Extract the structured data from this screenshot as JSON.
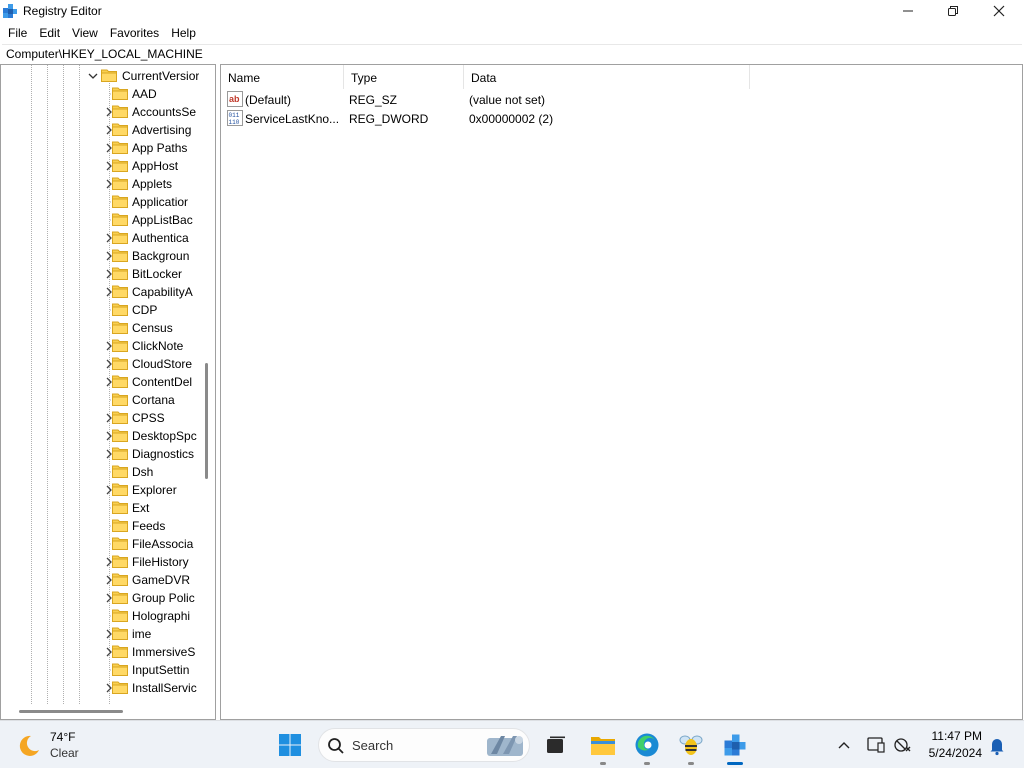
{
  "window": {
    "title": "Registry Editor",
    "icon": "registry-editor-icon",
    "controls": [
      "minimize-icon",
      "maximize-icon",
      "close-icon"
    ]
  },
  "menu": [
    "File",
    "Edit",
    "View",
    "Favorites",
    "Help"
  ],
  "address": "Computer\\HKEY_LOCAL_MACHINE",
  "tree": {
    "parent": {
      "label": "CurrentVersior",
      "expanded": true
    },
    "items": [
      {
        "label": "AAD",
        "expandable": false
      },
      {
        "label": "AccountsSe",
        "expandable": true
      },
      {
        "label": "Advertising",
        "expandable": true
      },
      {
        "label": "App Paths",
        "expandable": true
      },
      {
        "label": "AppHost",
        "expandable": true
      },
      {
        "label": "Applets",
        "expandable": true
      },
      {
        "label": "Applicatior",
        "expandable": false
      },
      {
        "label": "AppListBac",
        "expandable": false
      },
      {
        "label": "Authentica",
        "expandable": true
      },
      {
        "label": "Backgroun",
        "expandable": true
      },
      {
        "label": "BitLocker",
        "expandable": true
      },
      {
        "label": "CapabilityA",
        "expandable": true
      },
      {
        "label": "CDP",
        "expandable": false
      },
      {
        "label": "Census",
        "expandable": false
      },
      {
        "label": "ClickNote",
        "expandable": true
      },
      {
        "label": "CloudStore",
        "expandable": true
      },
      {
        "label": "ContentDel",
        "expandable": true
      },
      {
        "label": "Cortana",
        "expandable": false
      },
      {
        "label": "CPSS",
        "expandable": true
      },
      {
        "label": "DesktopSpc",
        "expandable": true
      },
      {
        "label": "Diagnostics",
        "expandable": true
      },
      {
        "label": "Dsh",
        "expandable": false
      },
      {
        "label": "Explorer",
        "expandable": true
      },
      {
        "label": "Ext",
        "expandable": false
      },
      {
        "label": "Feeds",
        "expandable": false
      },
      {
        "label": "FileAssocia",
        "expandable": false
      },
      {
        "label": "FileHistory",
        "expandable": true
      },
      {
        "label": "GameDVR",
        "expandable": true
      },
      {
        "label": "Group Polic",
        "expandable": true
      },
      {
        "label": "Holographi",
        "expandable": false
      },
      {
        "label": "ime",
        "expandable": true
      },
      {
        "label": "ImmersiveS",
        "expandable": true
      },
      {
        "label": "InputSettin",
        "expandable": false
      },
      {
        "label": "InstallServic",
        "expandable": true
      }
    ]
  },
  "list": {
    "columns": [
      "Name",
      "Type",
      "Data"
    ],
    "rows": [
      {
        "name": "(Default)",
        "type": "REG_SZ",
        "data": "(value not set)",
        "icon": "string-value-icon"
      },
      {
        "name": "ServiceLastKno...",
        "type": "REG_DWORD",
        "data": "0x00000002 (2)",
        "icon": "binary-value-icon"
      }
    ]
  },
  "taskbar": {
    "weather": {
      "temp": "74°F",
      "condition": "Clear",
      "icon": "moon-icon"
    },
    "search_placeholder": "Search",
    "apps": [
      "start-icon",
      "search-icon",
      "task-view-icon",
      "file-explorer-icon",
      "edge-icon",
      "bee-app-icon",
      "registry-editor-icon"
    ],
    "tray_icons": [
      "chevron-up-icon",
      "device-icon",
      "network-off-icon",
      "notification-bell-icon"
    ],
    "time": "11:47 PM",
    "date": "5/24/2024"
  }
}
